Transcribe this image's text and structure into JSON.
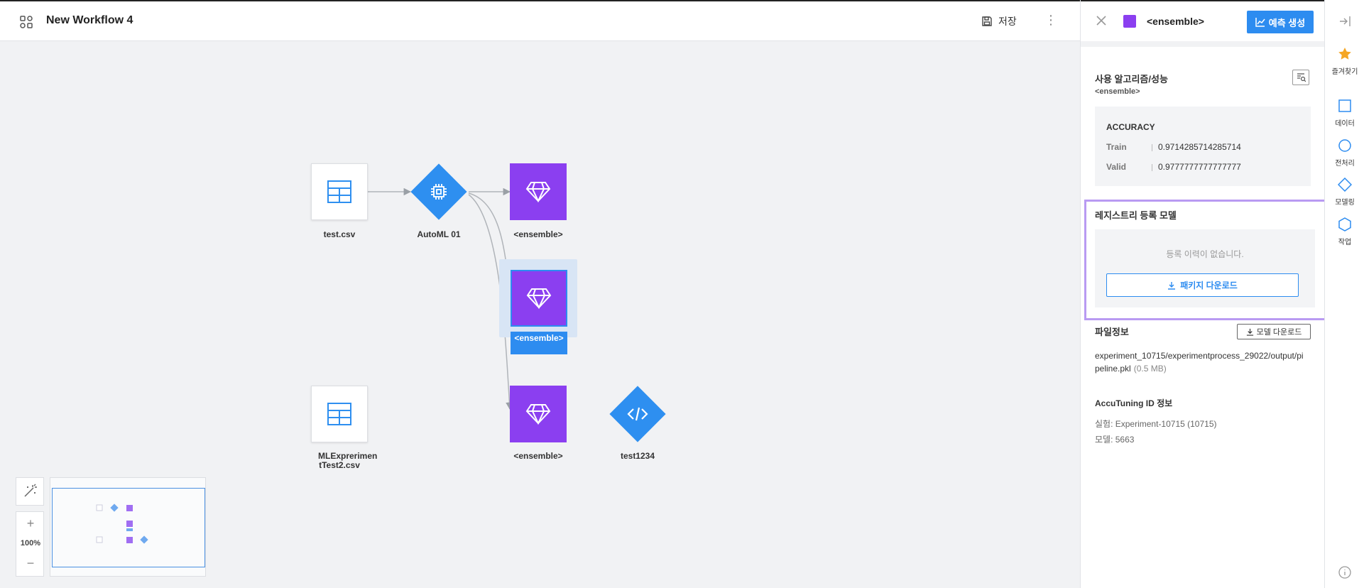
{
  "header": {
    "title": "New Workflow 4",
    "save_label": "저장"
  },
  "canvas": {
    "nodes": {
      "test_csv": "test.csv",
      "automl": "AutoML 01",
      "ensemble_1": "<ensemble>",
      "ensemble_2": "<ensemble>",
      "ensemble_3": "<ensemble>",
      "ml_csv": "MLExprerimen tTest2.csv",
      "test1234": "test1234"
    },
    "zoom": "100%"
  },
  "panel": {
    "title": "<ensemble>",
    "predict_label": "예측 생성",
    "algo_title": "사용 알고리즘/성능",
    "algo_sub": "<ensemble>",
    "accuracy": {
      "title": "ACCURACY",
      "train_label": "Train",
      "train_value": "0.9714285714285714",
      "valid_label": "Valid",
      "valid_value": "0.9777777777777777"
    },
    "registry": {
      "title": "레지스트리 등록 모델",
      "empty": "등록 이력이 없습니다.",
      "package_label": "패키지 다운로드"
    },
    "file": {
      "title": "파일정보",
      "download_label": "모델 다운로드",
      "path": "experiment_10715/experimentprocess_29022/output/pipeline.pkl",
      "size": "(0.5 MB)"
    },
    "accutuning": {
      "title": "AccuTuning ID 정보",
      "experiment": "실험: Experiment-10715 (10715)",
      "model": "모델: 5663"
    }
  },
  "rail": {
    "favorites": "즐겨찾기",
    "data": "데이터",
    "preprocess": "전처리",
    "modeling": "모델링",
    "job": "작업"
  },
  "colors": {
    "accent": "#2d8cf0",
    "model": "#8b3ff0",
    "highlight": "#b99af2",
    "star": "#f5a623"
  }
}
